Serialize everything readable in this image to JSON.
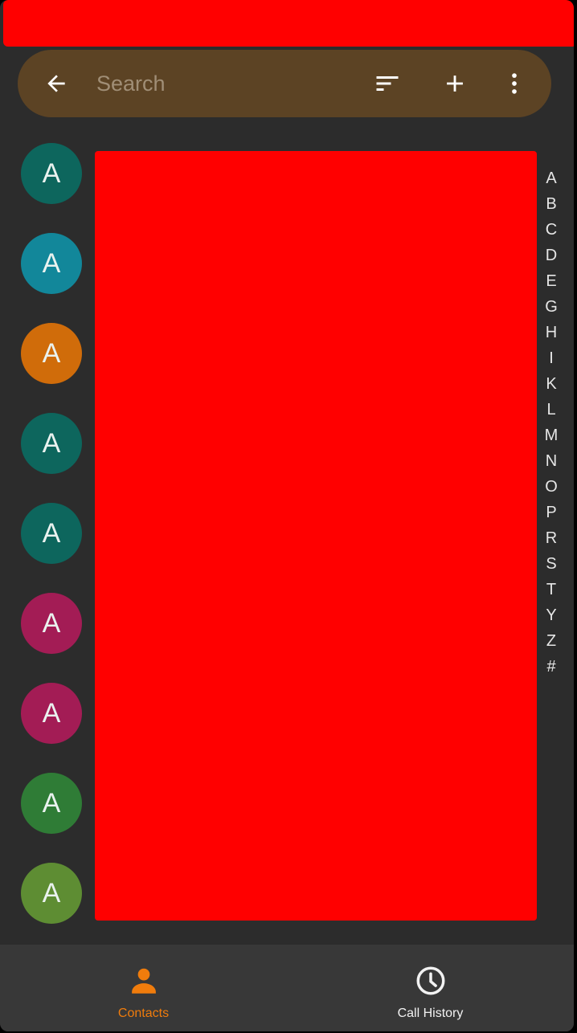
{
  "search": {
    "placeholder": "Search",
    "value": ""
  },
  "toolbar": {
    "back_icon": "arrow-left-icon",
    "sort_icon": "sort-icon",
    "add_icon": "plus-icon",
    "more_icon": "more-vertical-icon"
  },
  "contacts": [
    {
      "initial": "A",
      "color": "#0d665d"
    },
    {
      "initial": "A",
      "color": "#12879a"
    },
    {
      "initial": "A",
      "color": "#d06c0a"
    },
    {
      "initial": "A",
      "color": "#0d665d"
    },
    {
      "initial": "A",
      "color": "#0d665d"
    },
    {
      "initial": "A",
      "color": "#a31c55"
    },
    {
      "initial": "A",
      "color": "#a31c55"
    },
    {
      "initial": "A",
      "color": "#2f7c36"
    },
    {
      "initial": "A",
      "color": "#5e8d33"
    }
  ],
  "alphabet_index": [
    "A",
    "B",
    "C",
    "D",
    "E",
    "G",
    "H",
    "I",
    "K",
    "L",
    "M",
    "N",
    "O",
    "P",
    "R",
    "S",
    "T",
    "Y",
    "Z",
    "#"
  ],
  "bottom_nav": {
    "tabs": [
      {
        "label": "Contacts",
        "icon": "person-icon",
        "active": true
      },
      {
        "label": "Call History",
        "icon": "clock-icon",
        "active": false
      }
    ]
  },
  "colors": {
    "accent": "#f07c0c",
    "search_bar": "#5c4324",
    "background": "#2c2c2c",
    "nav_background": "#383838"
  }
}
